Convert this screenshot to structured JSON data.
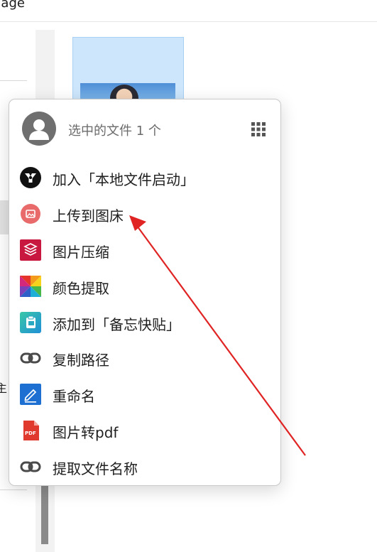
{
  "window": {
    "title_fragment": "nage",
    "left_pane_stub": "主"
  },
  "menu": {
    "header": {
      "label": "选中的文件 1 个",
      "avatar_icon": "user-avatar-icon",
      "grid_icon": "grid-dots-icon"
    },
    "items": [
      {
        "label": "加入「本地文件启动」",
        "icon": "launcher-logo-icon"
      },
      {
        "label": "上传到图床",
        "icon": "image-upload-icon"
      },
      {
        "label": "图片压缩",
        "icon": "layers-compress-icon"
      },
      {
        "label": "颜色提取",
        "icon": "color-palette-icon"
      },
      {
        "label": "添加到「备忘快贴」",
        "icon": "clipboard-icon"
      },
      {
        "label": "复制路径",
        "icon": "link-icon"
      },
      {
        "label": "重命名",
        "icon": "pen-icon"
      },
      {
        "label": "图片转pdf",
        "icon": "pdf-icon"
      },
      {
        "label": "提取文件名称",
        "icon": "link-icon"
      }
    ]
  },
  "colors": {
    "annotation_arrow": "#e02424",
    "upload_icon_bg": "#e86a6a",
    "compress_icon_bg": "#c8183f",
    "pen_icon_bg": "#1d6fd1",
    "pdf_icon": "#e03a2e"
  }
}
